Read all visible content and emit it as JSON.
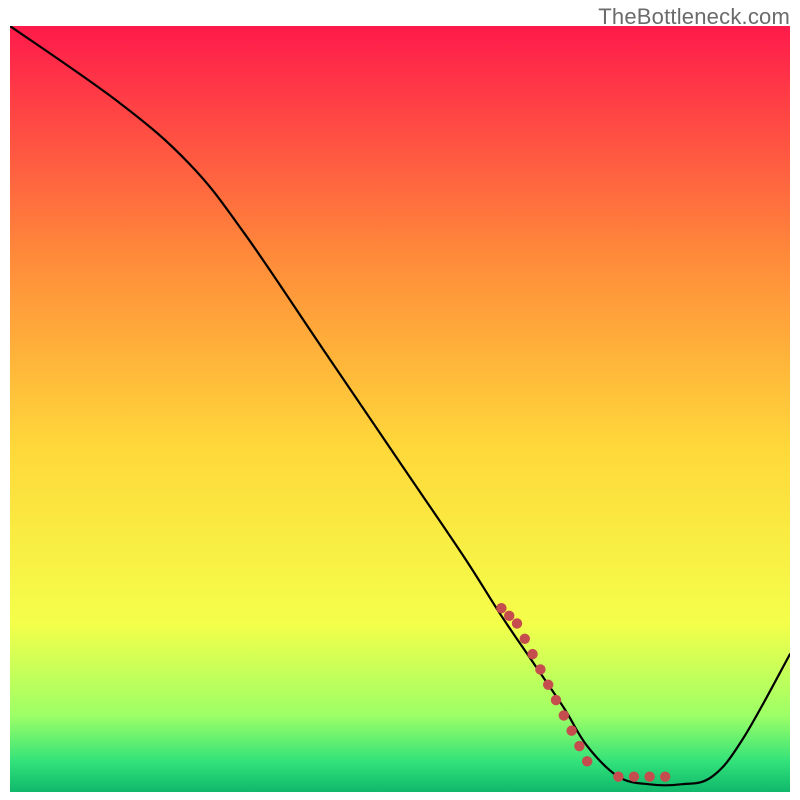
{
  "watermark": "TheBottleneck.com",
  "colors": {
    "gradient_top": "#ff1a4b",
    "gradient_upper_mid": "#ff8a3a",
    "gradient_mid": "#ffd83a",
    "gradient_lower_mid": "#f4ff4a",
    "gradient_green1": "#9dff66",
    "gradient_green2": "#33e27a",
    "gradient_bottom": "#0fb86b",
    "black_line": "#000000",
    "red_dots": "#c54d4d"
  },
  "chart_data": {
    "type": "line",
    "title": "",
    "xlabel": "",
    "ylabel": "",
    "xlim": [
      0,
      100
    ],
    "ylim": [
      0,
      100
    ],
    "series": [
      {
        "name": "black-curve",
        "x": [
          0,
          14,
          23,
          30,
          40,
          50,
          58,
          63,
          67,
          71,
          74,
          78,
          82,
          86,
          90,
          94,
          100
        ],
        "y": [
          100,
          90,
          82,
          73,
          58,
          43,
          31,
          23,
          17,
          11,
          6,
          2,
          1,
          1,
          2,
          7,
          18
        ]
      },
      {
        "name": "red-dots",
        "x": [
          63,
          64,
          65,
          66,
          67,
          68,
          69,
          70,
          71,
          72,
          73,
          74,
          78,
          80,
          82,
          84
        ],
        "y": [
          24,
          23,
          22,
          20,
          18,
          16,
          14,
          12,
          10,
          8,
          6,
          4,
          2,
          2,
          2,
          2
        ]
      }
    ]
  }
}
